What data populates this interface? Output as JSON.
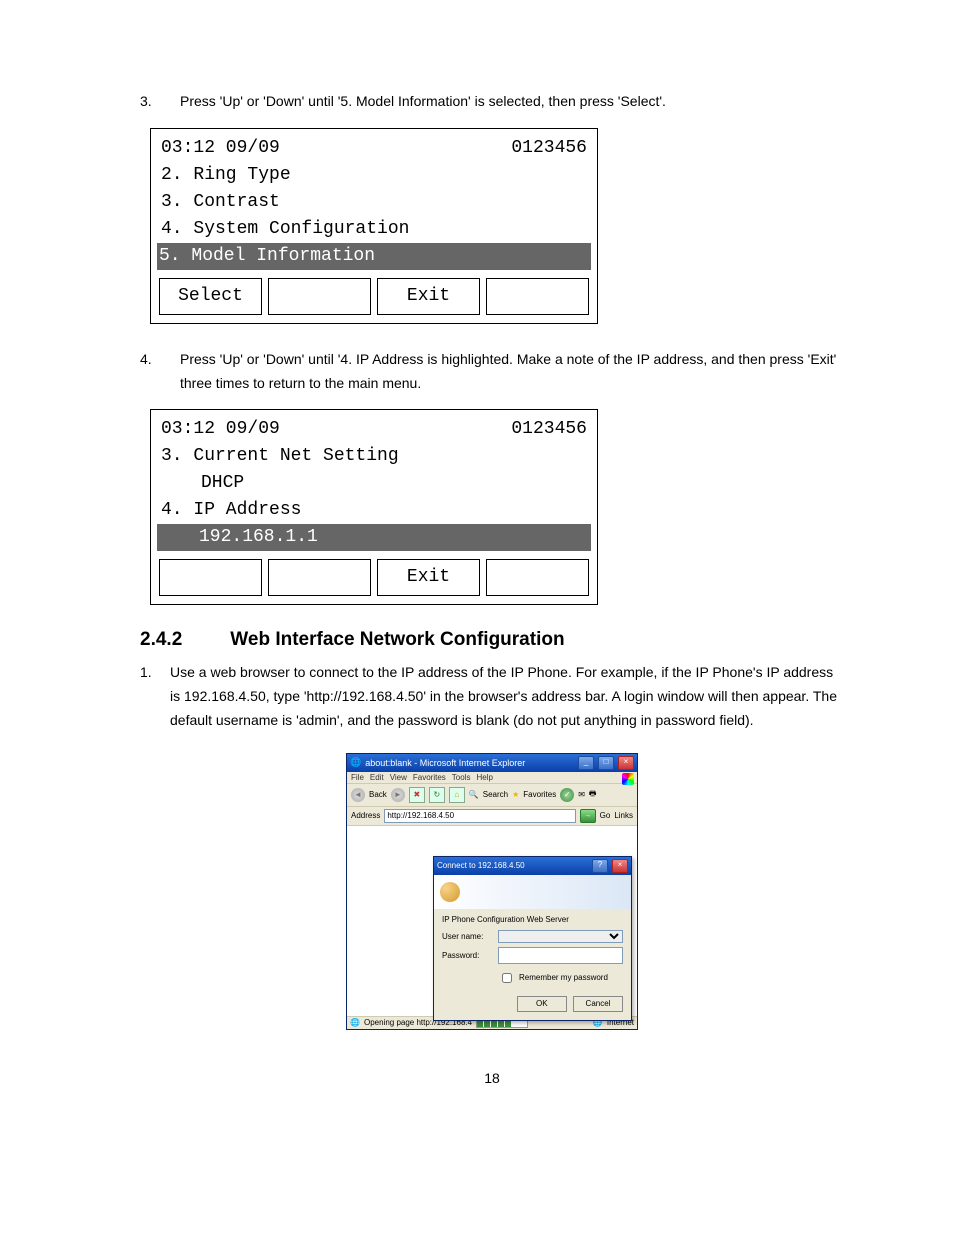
{
  "step3": {
    "num": "3.",
    "text": "Press 'Up' or 'Down' until '5. Model Information' is selected, then press 'Select'."
  },
  "lcd1": {
    "time": "03:12 09/09",
    "id": "0123456",
    "lines": [
      "2. Ring Type",
      "3. Contrast",
      "4. System Configuration"
    ],
    "selected": "5. Model Information",
    "soft_left": "Select",
    "soft_mid": "Exit"
  },
  "step4": {
    "num": "4.",
    "text": "Press 'Up' or 'Down' until '4. IP Address is highlighted.   Make a note of the IP address, and then press 'Exit' three times to return to the main menu."
  },
  "lcd2": {
    "time": "03:12 09/09",
    "id": "0123456",
    "lines": [
      "3. Current Net Setting"
    ],
    "indent": "DHCP",
    "line2": "4. IP Address",
    "selected": "192.168.1.1",
    "soft_mid": "Exit"
  },
  "section": {
    "num": "2.4.2",
    "title": "Web Interface Network Configuration"
  },
  "step1b": {
    "num": "1.",
    "text": "Use a web browser to connect to the IP address of the IP Phone. For example, if the IP Phone's IP address is 192.168.4.50, type 'http://192.168.4.50' in the browser's address bar. A login window will then appear.   The default username is 'admin', and the password is blank (do not put anything in password field)."
  },
  "ie": {
    "title": "about:blank - Microsoft Internet Explorer",
    "menu": [
      "File",
      "Edit",
      "View",
      "Favorites",
      "Tools",
      "Help"
    ],
    "back": "Back",
    "search": "Search",
    "fav": "Favorites",
    "addr_label": "Address",
    "addr_value": "http://192.168.4.50",
    "go": "Go",
    "links": "Links",
    "status": "Opening page http://192.168.4",
    "zone": "Internet"
  },
  "dlg": {
    "title": "Connect to 192.168.4.50",
    "realm": "IP Phone Configuration Web Server",
    "user_label": "User name:",
    "pass_label": "Password:",
    "remember": "Remember my password",
    "ok": "OK",
    "cancel": "Cancel"
  },
  "page_num": "18"
}
